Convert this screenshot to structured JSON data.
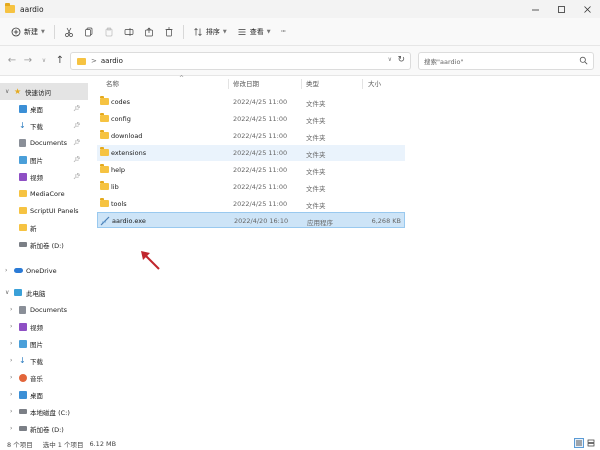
{
  "window": {
    "title": "aardio",
    "controls": [
      "minimize",
      "maximize",
      "close"
    ]
  },
  "toolbar": {
    "new_label": "新建",
    "sort_label": "排序",
    "view_label": "查看",
    "more_label": "···"
  },
  "nav": {
    "breadcrumb": [
      ">",
      "aardio"
    ],
    "search_placeholder": "搜索\"aardio\""
  },
  "sidebar": {
    "quick_access": "快速访问",
    "items": [
      {
        "label": "桌面",
        "icon": "desktop-icon",
        "pinned": true
      },
      {
        "label": "下载",
        "icon": "download-icon",
        "pinned": true
      },
      {
        "label": "Documents",
        "icon": "document-icon",
        "pinned": true
      },
      {
        "label": "图片",
        "icon": "pictures-icon",
        "pinned": true
      },
      {
        "label": "视频",
        "icon": "video-icon",
        "pinned": true
      },
      {
        "label": "MediaCore",
        "icon": "folder-icon",
        "pinned": false
      },
      {
        "label": "ScriptUI Panels",
        "icon": "folder-icon",
        "pinned": false
      },
      {
        "label": "新",
        "icon": "folder-icon",
        "pinned": false
      },
      {
        "label": "新加卷 (D:)",
        "icon": "drive-icon",
        "pinned": false
      }
    ],
    "onedrive": "OneDrive",
    "this_pc": "此电脑",
    "pc_items": [
      {
        "label": "Documents",
        "icon": "document-icon"
      },
      {
        "label": "视频",
        "icon": "video-icon"
      },
      {
        "label": "图片",
        "icon": "pictures-icon"
      },
      {
        "label": "下载",
        "icon": "download-icon"
      },
      {
        "label": "音乐",
        "icon": "music-icon"
      },
      {
        "label": "桌面",
        "icon": "desktop-icon"
      },
      {
        "label": "本地磁盘 (C:)",
        "icon": "drive-icon"
      },
      {
        "label": "新加卷 (D:)",
        "icon": "drive-icon"
      }
    ]
  },
  "columns": {
    "name": "名称",
    "date": "修改日期",
    "type": "类型",
    "size": "大小"
  },
  "files": [
    {
      "name": "codes",
      "date": "2022/4/25 11:00",
      "type": "文件夹",
      "size": "",
      "kind": "folder",
      "state": ""
    },
    {
      "name": "config",
      "date": "2022/4/25 11:00",
      "type": "文件夹",
      "size": "",
      "kind": "folder",
      "state": ""
    },
    {
      "name": "download",
      "date": "2022/4/25 11:00",
      "type": "文件夹",
      "size": "",
      "kind": "folder",
      "state": ""
    },
    {
      "name": "extensions",
      "date": "2022/4/25 11:00",
      "type": "文件夹",
      "size": "",
      "kind": "folder",
      "state": "highlighted"
    },
    {
      "name": "help",
      "date": "2022/4/25 11:00",
      "type": "文件夹",
      "size": "",
      "kind": "folder",
      "state": ""
    },
    {
      "name": "lib",
      "date": "2022/4/25 11:00",
      "type": "文件夹",
      "size": "",
      "kind": "folder",
      "state": ""
    },
    {
      "name": "tools",
      "date": "2022/4/25 11:00",
      "type": "文件夹",
      "size": "",
      "kind": "folder",
      "state": ""
    },
    {
      "name": "aardio.exe",
      "date": "2022/4/20 16:10",
      "type": "应用程序",
      "size": "6,268 KB",
      "kind": "exe",
      "state": "selected"
    }
  ],
  "status": {
    "count": "8 个项目",
    "selection": "选中 1 个项目",
    "size": "6.12 MB"
  },
  "colors": {
    "folder": "#f6c342",
    "selection": "#cde4f7",
    "annotation_arrow": "#c0262d"
  }
}
